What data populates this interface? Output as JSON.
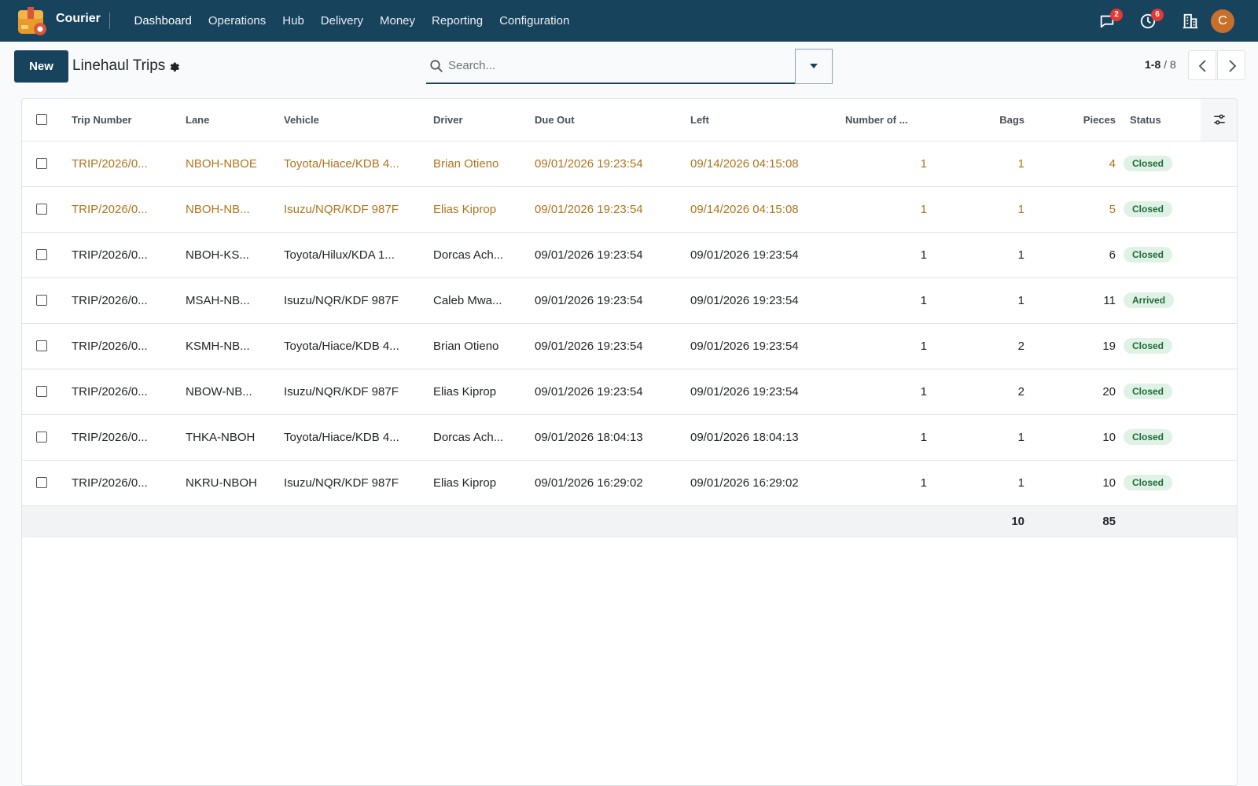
{
  "navbar": {
    "app_name": "Courier",
    "menu": [
      "Dashboard",
      "Operations",
      "Hub",
      "Delivery",
      "Money",
      "Reporting",
      "Configuration"
    ],
    "messages_count": "2",
    "activities_count": "6",
    "avatar_initial": "C",
    "icons": [
      "chat-icon",
      "clock-icon",
      "building-icon"
    ]
  },
  "control_panel": {
    "new_label": "New",
    "title": "Linehaul Trips",
    "search_placeholder": "Search...",
    "pager_range": "1-8",
    "pager_total": "/ 8"
  },
  "table": {
    "columns": [
      "Trip Number",
      "Lane",
      "Vehicle",
      "Driver",
      "Due Out",
      "Left",
      "Number of ...",
      "Bags",
      "Pieces",
      "Status"
    ],
    "rows": [
      {
        "trip": "TRIP/2026/0...",
        "lane": "NBOH-NBOE",
        "vehicle": "Toyota/Hiace/KDB 4...",
        "driver": "Brian Otieno",
        "due_out": "09/01/2026 19:23:54",
        "left": "09/14/2026 04:15:08",
        "number": "1",
        "bags": "1",
        "pieces": "4",
        "status": "Closed",
        "warn": true
      },
      {
        "trip": "TRIP/2026/0...",
        "lane": "NBOH-NB...",
        "vehicle": "Isuzu/NQR/KDF 987F",
        "driver": "Elias Kiprop",
        "due_out": "09/01/2026 19:23:54",
        "left": "09/14/2026 04:15:08",
        "number": "1",
        "bags": "1",
        "pieces": "5",
        "status": "Closed",
        "warn": true
      },
      {
        "trip": "TRIP/2026/0...",
        "lane": "NBOH-KS...",
        "vehicle": "Toyota/Hilux/KDA 1...",
        "driver": "Dorcas Ach...",
        "due_out": "09/01/2026 19:23:54",
        "left": "09/01/2026 19:23:54",
        "number": "1",
        "bags": "1",
        "pieces": "6",
        "status": "Closed",
        "warn": false
      },
      {
        "trip": "TRIP/2026/0...",
        "lane": "MSAH-NB...",
        "vehicle": "Isuzu/NQR/KDF 987F",
        "driver": "Caleb Mwa...",
        "due_out": "09/01/2026 19:23:54",
        "left": "09/01/2026 19:23:54",
        "number": "1",
        "bags": "1",
        "pieces": "11",
        "status": "Arrived",
        "warn": false
      },
      {
        "trip": "TRIP/2026/0...",
        "lane": "KSMH-NB...",
        "vehicle": "Toyota/Hiace/KDB 4...",
        "driver": "Brian Otieno",
        "due_out": "09/01/2026 19:23:54",
        "left": "09/01/2026 19:23:54",
        "number": "1",
        "bags": "2",
        "pieces": "19",
        "status": "Closed",
        "warn": false
      },
      {
        "trip": "TRIP/2026/0...",
        "lane": "NBOW-NB...",
        "vehicle": "Isuzu/NQR/KDF 987F",
        "driver": "Elias Kiprop",
        "due_out": "09/01/2026 19:23:54",
        "left": "09/01/2026 19:23:54",
        "number": "1",
        "bags": "2",
        "pieces": "20",
        "status": "Closed",
        "warn": false
      },
      {
        "trip": "TRIP/2026/0...",
        "lane": "THKA-NBOH",
        "vehicle": "Toyota/Hiace/KDB 4...",
        "driver": "Dorcas Ach...",
        "due_out": "09/01/2026 18:04:13",
        "left": "09/01/2026 18:04:13",
        "number": "1",
        "bags": "1",
        "pieces": "10",
        "status": "Closed",
        "warn": false
      },
      {
        "trip": "TRIP/2026/0...",
        "lane": "NKRU-NBOH",
        "vehicle": "Isuzu/NQR/KDF 987F",
        "driver": "Elias Kiprop",
        "due_out": "09/01/2026 16:29:02",
        "left": "09/01/2026 16:29:02",
        "number": "1",
        "bags": "1",
        "pieces": "10",
        "status": "Closed",
        "warn": false
      }
    ],
    "totals": {
      "bags": "10",
      "pieces": "85"
    }
  },
  "colors": {
    "navbar": "#17435d",
    "warning_text": "#b0741c",
    "status_bg": "#dff2e5",
    "status_text": "#1e6b3b",
    "avatar": "#c8702b",
    "badge": "#e53935"
  }
}
